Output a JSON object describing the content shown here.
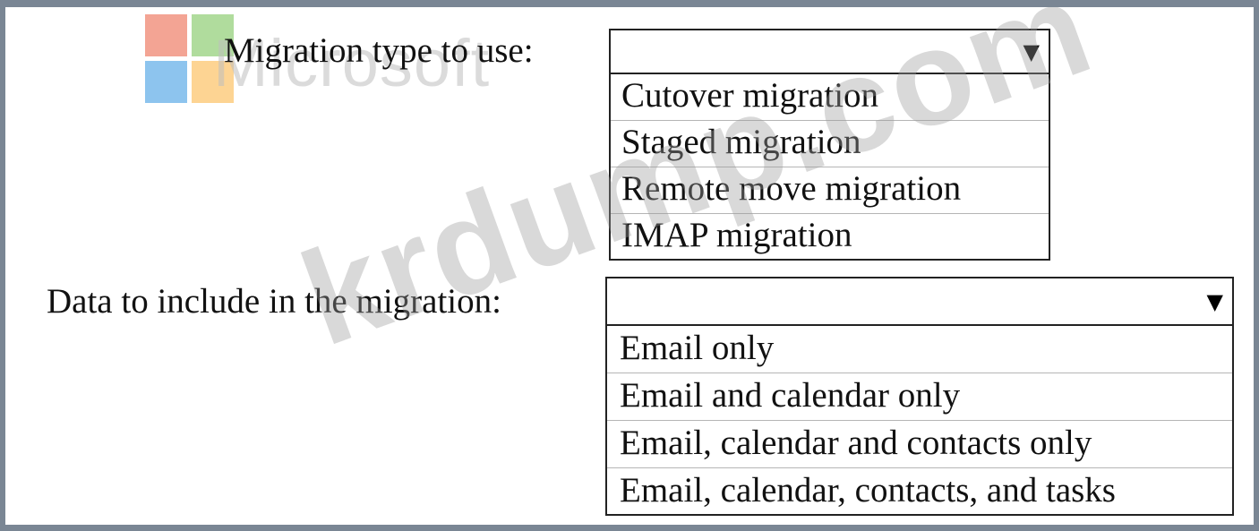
{
  "watermarks": {
    "logo_text": "Microsoft",
    "site_text": "krdump.com"
  },
  "colors": {
    "frame_border": "#7a8694",
    "logo_red": "#ea5a3c",
    "logo_green": "#6fbf4c",
    "logo_blue": "#2f94e0",
    "logo_yellow": "#fbb03b"
  },
  "migration_type": {
    "label": "Migration type to use:",
    "selected_value": "",
    "dropdown_icon": "triangle-down-icon",
    "options": [
      "Cutover migration",
      "Staged migration",
      "Remote move migration",
      "IMAP migration"
    ]
  },
  "data_to_include": {
    "label": "Data to include in the migration:",
    "selected_value": "",
    "dropdown_icon": "triangle-down-icon",
    "options": [
      "Email only",
      "Email and calendar only",
      "Email, calendar and contacts only",
      "Email, calendar, contacts, and tasks"
    ]
  }
}
